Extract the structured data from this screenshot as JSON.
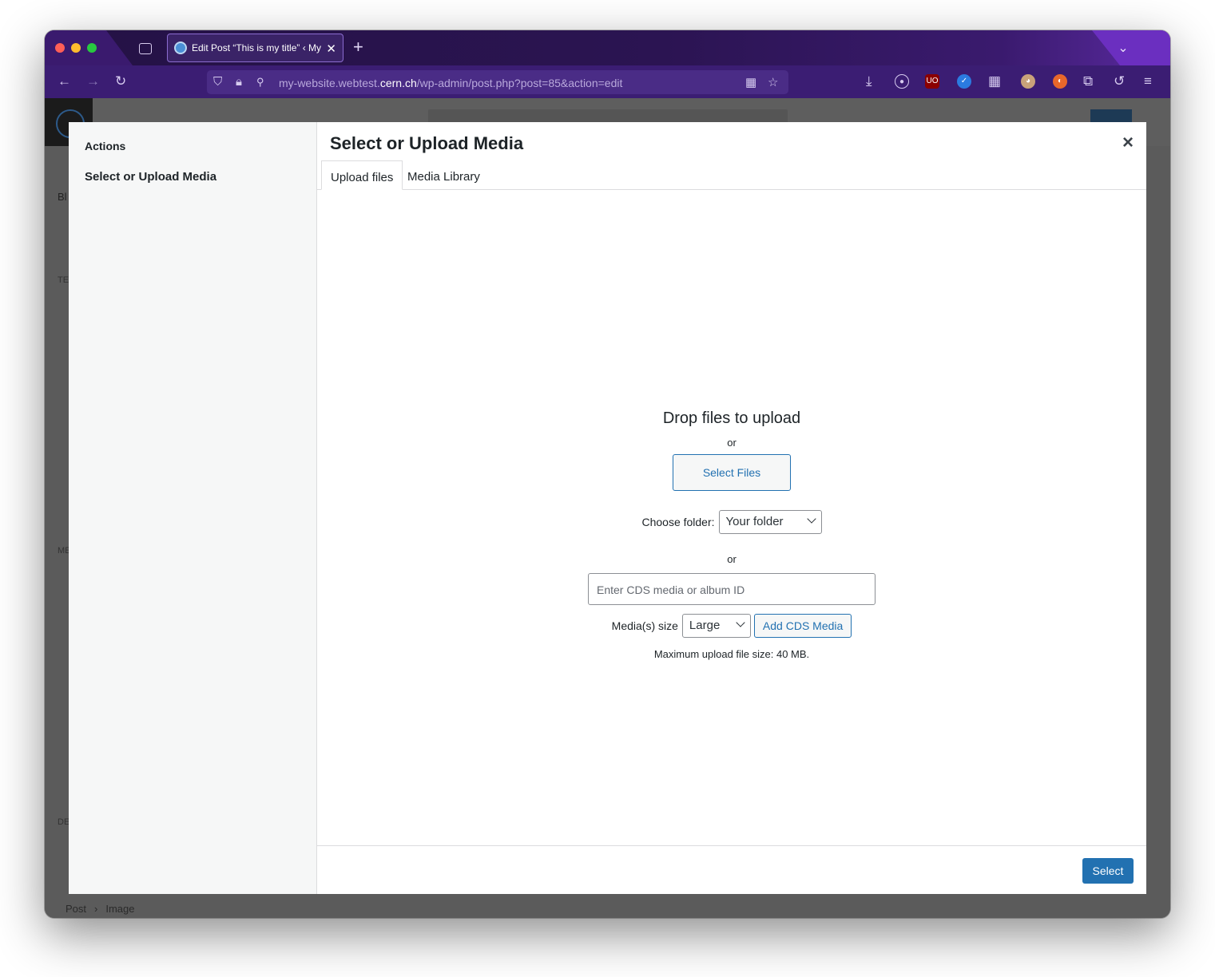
{
  "browser": {
    "tab_title": "Edit Post “This is my title” ‹ My",
    "url_prefix": "my-website.webtest.",
    "url_domain": "cern.ch",
    "url_path": "/wp-admin/post.php?post=85&action=edit"
  },
  "page": {
    "side_labels": [
      "Bl",
      "TE",
      "ME",
      "DE"
    ],
    "breadcrumb": [
      "Post",
      "›",
      "Image"
    ]
  },
  "modal": {
    "menu_heading": "Actions",
    "menu_item": "Select or Upload Media",
    "title": "Select or Upload Media",
    "close_label": "×",
    "tabs": [
      "Upload files",
      "Media Library"
    ],
    "drop_title": "Drop files to upload",
    "or_label": "or",
    "select_files_label": "Select Files",
    "choose_folder_label": "Choose folder:",
    "folder_value": "Your folder",
    "cds_placeholder": "Enter CDS media or album ID",
    "media_size_label": "Media(s) size",
    "media_size_value": "Large",
    "add_cds_label": "Add CDS Media",
    "max_upload": "Maximum upload file size: 40 MB.",
    "select_button": "Select"
  },
  "colors": {
    "primary": "#2271b1",
    "browser_bg": "#2b1452"
  }
}
